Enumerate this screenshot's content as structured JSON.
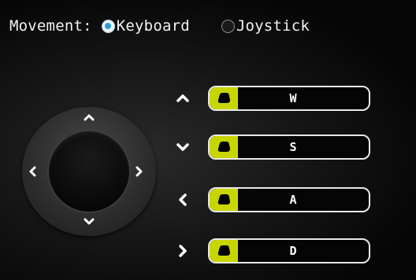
{
  "movement": {
    "label": "Movement:",
    "options": [
      {
        "label": "Keyboard",
        "selected": true
      },
      {
        "label": "Joystick",
        "selected": false
      }
    ]
  },
  "joystick": {
    "arrows": [
      "chevron-up-icon",
      "chevron-left-icon",
      "chevron-right-icon",
      "chevron-down-icon"
    ]
  },
  "key_bindings": [
    {
      "direction": "up",
      "icon": "chevron-up-icon",
      "key": "W"
    },
    {
      "direction": "down",
      "icon": "chevron-down-icon",
      "key": "S"
    },
    {
      "direction": "left",
      "icon": "chevron-left-icon",
      "key": "A"
    },
    {
      "direction": "right",
      "icon": "chevron-right-icon",
      "key": "D"
    }
  ],
  "colors": {
    "accent": "#c8d600",
    "radio_selected": "#2e9ad6",
    "background": "#050505"
  }
}
